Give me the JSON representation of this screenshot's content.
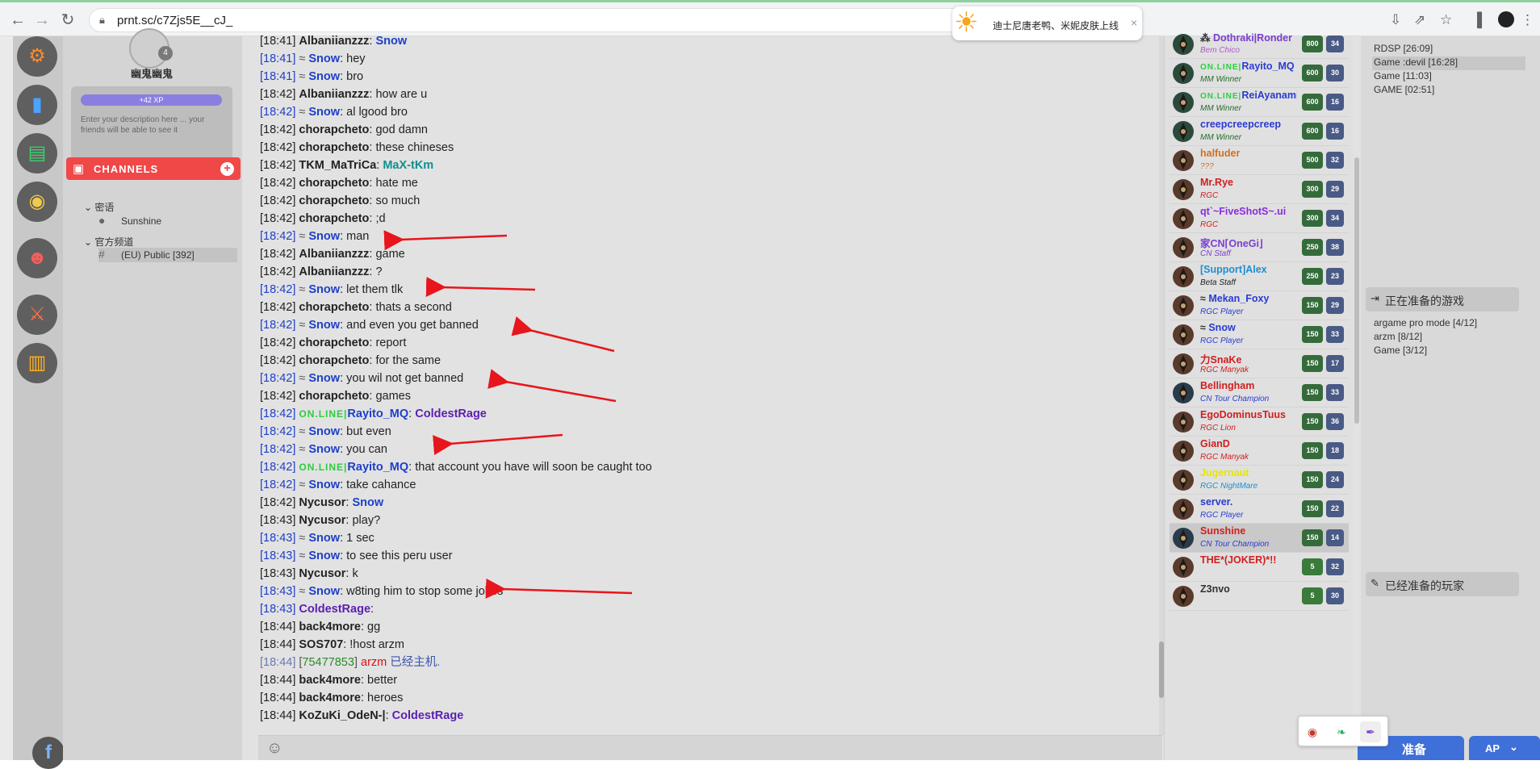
{
  "browser": {
    "url": "prnt.sc/c7Zjs5E__cJ_",
    "ad_text": "迪士尼唐老鸭、米妮皮肤上线"
  },
  "sidebar": {
    "username": "幽鬼幽鬼",
    "level": "4",
    "xp_label": "+42 XP",
    "description": "Enter your description here ... your friends will be able to see it",
    "channels_title": "CHANNELS",
    "groups": [
      {
        "label": "密语",
        "items": [
          {
            "label": "Sunshine"
          }
        ]
      },
      {
        "label": "官方频道",
        "items": [
          {
            "label": "(EU) Public [392]"
          }
        ]
      }
    ]
  },
  "chat": {
    "lines": [
      {
        "time": "18:41",
        "nick": "Albaniianzzz",
        "sep": ": ",
        "msg": "Snow",
        "msg_style": "blue",
        "you": false
      },
      {
        "time": "18:41",
        "nick": "Snow",
        "msg": "hey",
        "you": true
      },
      {
        "time": "18:41",
        "nick": "Snow",
        "msg": "bro",
        "you": true
      },
      {
        "time": "18:42",
        "nick": "Albaniianzzz",
        "msg": "how are u",
        "you": false
      },
      {
        "time": "18:42",
        "nick": "Snow",
        "msg": "al lgood bro",
        "you": true
      },
      {
        "time": "18:42",
        "nick": "chorapcheto",
        "msg": "god damn",
        "you": false
      },
      {
        "time": "18:42",
        "nick": "chorapcheto",
        "msg": "these chineses",
        "you": false
      },
      {
        "time": "18:42",
        "nick": "TKM_MaTriCa",
        "msg": "MaX-tKm",
        "msg_style": "teal",
        "you": false
      },
      {
        "time": "18:42",
        "nick": "chorapcheto",
        "msg": "hate me",
        "you": false
      },
      {
        "time": "18:42",
        "nick": "chorapcheto",
        "msg": "so much",
        "you": false
      },
      {
        "time": "18:42",
        "nick": "chorapcheto",
        "msg": ";d",
        "you": false
      },
      {
        "time": "18:42",
        "nick": "Snow",
        "msg": "man",
        "you": true
      },
      {
        "time": "18:42",
        "nick": "Albaniianzzz",
        "msg": "game",
        "you": false
      },
      {
        "time": "18:42",
        "nick": "Albaniianzzz",
        "msg": "?",
        "you": false
      },
      {
        "time": "18:42",
        "nick": "Snow",
        "msg": "let them tlk",
        "you": true
      },
      {
        "time": "18:42",
        "nick": "chorapcheto",
        "msg": "thats a second",
        "you": false
      },
      {
        "time": "18:42",
        "nick": "Snow",
        "msg": "and even you get banned",
        "you": true
      },
      {
        "time": "18:42",
        "nick": "chorapcheto",
        "msg": "report",
        "you": false
      },
      {
        "time": "18:42",
        "nick": "chorapcheto",
        "msg": "for the same",
        "you": false
      },
      {
        "time": "18:42",
        "nick": "Snow",
        "msg": "you wil not get banned",
        "you": true
      },
      {
        "time": "18:42",
        "nick": "chorapcheto",
        "msg": "games",
        "you": false
      },
      {
        "time": "18:42",
        "nick": "Rayito_MQ",
        "online": true,
        "msg": "ColdestRage",
        "msg_style": "purple",
        "you": true
      },
      {
        "time": "18:42",
        "nick": "Snow",
        "msg": "but even",
        "you": true
      },
      {
        "time": "18:42",
        "nick": "Snow",
        "msg": "you can",
        "you": true
      },
      {
        "time": "18:42",
        "nick": "Rayito_MQ",
        "online": true,
        "msg": "that account you have will soon be caught too",
        "you": true
      },
      {
        "time": "18:42",
        "nick": "Snow",
        "msg": "take cahance",
        "you": true
      },
      {
        "time": "18:42",
        "nick": "Nycusor",
        "msg": "Snow",
        "msg_style": "blue",
        "you": false
      },
      {
        "time": "18:43",
        "nick": "Nycusor",
        "msg": "play?",
        "you": false
      },
      {
        "time": "18:43",
        "nick": "Snow",
        "msg": "1 sec",
        "you": true
      },
      {
        "time": "18:43",
        "nick": "Snow",
        "msg": "to see this peru user",
        "you": true
      },
      {
        "time": "18:43",
        "nick": "Nycusor",
        "msg": "k",
        "you": false
      },
      {
        "time": "18:43",
        "nick": "Snow",
        "msg": "w8ting him to stop some jokes",
        "you": true
      },
      {
        "time": "18:43",
        "nick": "ColdestRage",
        "msg": "",
        "you": true,
        "purple_nick": true
      },
      {
        "time": "18:44",
        "nick": "back4more",
        "msg": "gg",
        "you": false
      },
      {
        "time": "18:44",
        "nick": "SOS707",
        "msg": "!host arzm",
        "you": false
      },
      {
        "time": "18:44",
        "system": true,
        "num": "75477853",
        "name": "arzm",
        "sysmsg": "已经主机."
      },
      {
        "time": "18:44",
        "nick": "back4more",
        "msg": "better",
        "you": false
      },
      {
        "time": "18:44",
        "nick": "back4more",
        "msg": "heroes",
        "you": false
      },
      {
        "time": "18:44",
        "nick": "KoZuKi_OdeN-|",
        "msg": "ColdestRage",
        "msg_style": "purple",
        "you": false
      }
    ],
    "online_tag": "ON.LINE|",
    "snow_prefix": "≈ "
  },
  "players": [
    {
      "name": "Dothraki|Ronder",
      "tag": "Bem Chico",
      "pts": "800",
      "lvl": "34",
      "ncol": "#7b3fd0",
      "tcol": "#b05ac8",
      "prefix": "⁂ "
    },
    {
      "name": "Rayito_MQ",
      "tag": "MM Winner",
      "pts": "600",
      "lvl": "30",
      "ncol": "#2a3bd0",
      "tcol": "#256b2a",
      "online": true
    },
    {
      "name": "ReiAyanami",
      "tag": "MM Winner",
      "pts": "600",
      "lvl": "16",
      "ncol": "#2a3bd0",
      "tcol": "#256b2a",
      "online": true
    },
    {
      "name": "creepcreepcreep",
      "tag": "MM Winner",
      "pts": "600",
      "lvl": "16",
      "ncol": "#2a3bd0",
      "tcol": "#256b2a"
    },
    {
      "name": "halfuder",
      "tag": "???",
      "pts": "500",
      "lvl": "32",
      "ncol": "#d07020",
      "tcol": "#d07020"
    },
    {
      "name": "Mr.Rye",
      "tag": "RGC",
      "pts": "300",
      "lvl": "29",
      "ncol": "#d02020",
      "tcol": "#d02020"
    },
    {
      "name": "qt`~FiveShotS~.ui",
      "tag": "RGC",
      "pts": "300",
      "lvl": "34",
      "ncol": "#8a2be2",
      "tcol": "#d02020"
    },
    {
      "name": "家CN⌈OneGi⌋",
      "tag": "CN Staff",
      "pts": "250",
      "lvl": "38",
      "ncol": "#7b3fd0",
      "tcol": "#7b3fd0"
    },
    {
      "name": "[Support]Alex",
      "tag": "Beta Staff",
      "pts": "250",
      "lvl": "23",
      "ncol": "#1e8fd0",
      "tcol": "#222"
    },
    {
      "name": "Mekan_Foxy",
      "tag": "RGC Player",
      "pts": "150",
      "lvl": "29",
      "ncol": "#2a3bd0",
      "tcol": "#2a3bd0",
      "prefix": "≈ "
    },
    {
      "name": "Snow",
      "tag": "RGC Player",
      "pts": "150",
      "lvl": "33",
      "ncol": "#2a3bd0",
      "tcol": "#2a3bd0",
      "prefix": "≈ "
    },
    {
      "name": "力SnaKe",
      "tag": "RGC Manyak",
      "pts": "150",
      "lvl": "17",
      "ncol": "#d02020",
      "tcol": "#d02020"
    },
    {
      "name": "Bellingham",
      "tag": "CN Tour Champion",
      "pts": "150",
      "lvl": "33",
      "ncol": "#d02020",
      "tcol": "#2a3bd0"
    },
    {
      "name": "EgoDominusTuus",
      "tag": "RGC Lion",
      "pts": "150",
      "lvl": "36",
      "ncol": "#d02020",
      "tcol": "#d02020"
    },
    {
      "name": "GianD",
      "tag": "RGC Manyak",
      "pts": "150",
      "lvl": "18",
      "ncol": "#d02020",
      "tcol": "#d02020"
    },
    {
      "name": "Jugernaut",
      "tag": "RGC NightMare",
      "pts": "150",
      "lvl": "24",
      "ncol": "#e6e600",
      "tcol": "#1e8fd0"
    },
    {
      "name": "server.",
      "tag": "RGC Player",
      "pts": "150",
      "lvl": "22",
      "ncol": "#2a3bd0",
      "tcol": "#2a3bd0"
    },
    {
      "name": "Sunshine",
      "tag": "CN Tour Champion",
      "pts": "150",
      "lvl": "14",
      "ncol": "#d02020",
      "tcol": "#2a3bd0",
      "hl": true
    },
    {
      "name": "THE*(JOKER)*!!",
      "tag": "",
      "pts": "5",
      "lvl": "32",
      "ncol": "#d02020",
      "tcol": "#222"
    },
    {
      "name": "Z3nvo",
      "tag": "",
      "pts": "5",
      "lvl": "30",
      "ncol": "#333",
      "tcol": "#222"
    }
  ],
  "right": {
    "games_top": [
      {
        "label": "RDSP [26:09]"
      },
      {
        "label": "Game :devil [16:28]",
        "hl": true
      },
      {
        "label": "Game [11:03]"
      },
      {
        "label": "GAME [02:51]"
      }
    ],
    "preparing_title": "正在准备的游戏",
    "preparing_games": [
      {
        "label": "argame pro mode [4/12]"
      },
      {
        "label": "arzm [8/12]"
      },
      {
        "label": "Game [3/12]"
      }
    ],
    "ready_players_title": "已经准备的玩家",
    "ready_button": "准备",
    "ap_button": "AP"
  }
}
